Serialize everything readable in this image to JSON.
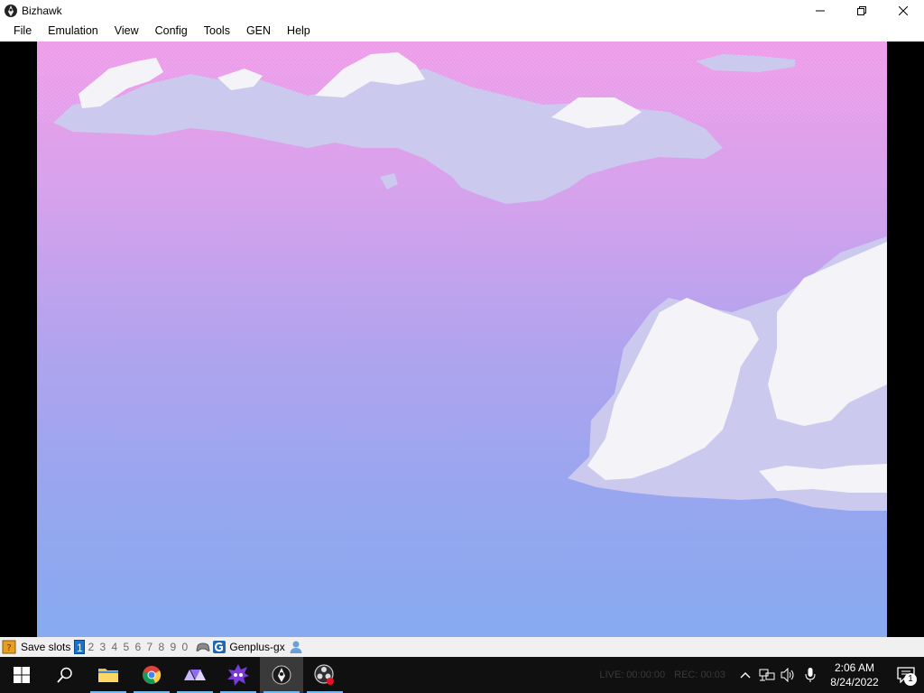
{
  "window": {
    "title": "Bizhawk",
    "controls": [
      "minimize",
      "maximize",
      "close"
    ]
  },
  "menu": {
    "items": [
      "File",
      "Emulation",
      "View",
      "Config",
      "Tools",
      "GEN",
      "Help"
    ]
  },
  "game_screen": {
    "description_icon": "sky-with-clouds",
    "colors": {
      "sky_top": "#ee9ee8",
      "sky_mid_high": "#d7a2ec",
      "sky_mid": "#b3a3ee",
      "sky_low": "#98a6ef",
      "sky_bottom": "#87aaf0",
      "cloud_light": "#f4f4f8",
      "cloud_shade": "#ccc9ee"
    }
  },
  "statusbar": {
    "label": "Save slots",
    "slots": [
      "1",
      "2",
      "3",
      "4",
      "5",
      "6",
      "7",
      "8",
      "9",
      "0"
    ],
    "active_slot": "1",
    "core": "Genplus-gx"
  },
  "taskbar": {
    "apps": [
      "start",
      "search",
      "file-explorer",
      "chrome",
      "app-triangles",
      "app-purple-creature",
      "bizhawk",
      "obs-studio"
    ],
    "ghost_live": "LIVE: 00:00:00",
    "ghost_rec": "REC: 00:03",
    "time": "2:06 AM",
    "date": "8/24/2022",
    "notification_count": "1"
  }
}
